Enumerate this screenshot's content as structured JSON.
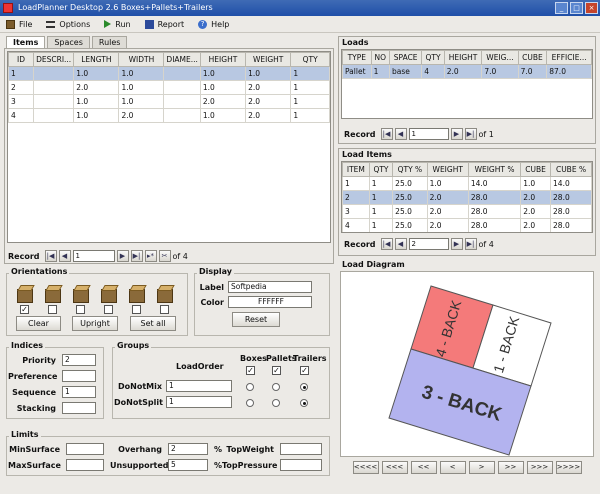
{
  "window": {
    "title": "LoadPlanner Desktop 2.6 Boxes+Pallets+Trailers"
  },
  "menu": {
    "file": "File",
    "options": "Options",
    "run": "Run",
    "report": "Report",
    "help": "Help"
  },
  "tabs": [
    "Items",
    "Spaces",
    "Rules"
  ],
  "items_table": {
    "headers": [
      "ID",
      "DESCRI...",
      "LENGTH",
      "WIDTH",
      "DIAME...",
      "HEIGHT",
      "WEIGHT",
      "QTY"
    ],
    "rows": [
      [
        "1",
        "",
        "1.0",
        "1.0",
        "",
        "1.0",
        "1.0",
        "1"
      ],
      [
        "2",
        "",
        "2.0",
        "1.0",
        "",
        "1.0",
        "2.0",
        "1"
      ],
      [
        "3",
        "",
        "1.0",
        "1.0",
        "",
        "2.0",
        "2.0",
        "1"
      ],
      [
        "4",
        "",
        "1.0",
        "2.0",
        "",
        "1.0",
        "2.0",
        "1"
      ]
    ]
  },
  "items_record": {
    "label": "Record",
    "value": "1",
    "of": "of 4"
  },
  "orientations": {
    "title": "Orientations",
    "clear": "Clear",
    "upright": "Upright",
    "set_all": "Set all"
  },
  "display": {
    "title": "Display",
    "label_label": "Label",
    "label_value": "Softpedia",
    "color_label": "Color",
    "color_value": "FFFFFF",
    "reset": "Reset"
  },
  "indices": {
    "title": "Indices",
    "priority_label": "Priority",
    "priority_value": "2",
    "preference_label": "Preference",
    "preference_value": "",
    "sequence_label": "Sequence",
    "sequence_value": "1",
    "stacking_label": "Stacking",
    "stacking_value": ""
  },
  "groups": {
    "title": "Groups",
    "loadorder": "LoadOrder",
    "boxes": "Boxes",
    "pallets": "Pallets",
    "trailers": "Trailers",
    "donotmix_label": "DoNotMix",
    "donotmix_value": "1",
    "donotsplit_label": "DoNotSplit",
    "donotsplit_value": "1"
  },
  "limits": {
    "title": "Limits",
    "minsurface": "MinSurface",
    "minsurface_value": "",
    "maxsurface": "MaxSurface",
    "maxsurface_value": "",
    "overhang": "Overhang",
    "overhang_value": "2",
    "unsupported": "Unsupported",
    "unsupported_value": "5",
    "pct": "%",
    "topweight": "TopWeight",
    "topweight_value": "",
    "toppressure": "TopPressure",
    "toppressure_value": ""
  },
  "loads": {
    "title": "Loads",
    "headers": [
      "TYPE",
      "NO",
      "SPACE",
      "QTY",
      "HEIGHT",
      "WEIG...",
      "CUBE",
      "EFFICIE..."
    ],
    "rows": [
      [
        "Pallet",
        "1",
        "base",
        "4",
        "2.0",
        "7.0",
        "7.0",
        "87.0"
      ]
    ],
    "record_label": "Record",
    "record_value": "1",
    "of": "of 1"
  },
  "load_items": {
    "title": "Load Items",
    "headers": [
      "ITEM",
      "QTY",
      "QTY %",
      "WEIGHT",
      "WEIGHT %",
      "CUBE",
      "CUBE %"
    ],
    "rows": [
      [
        "1",
        "1",
        "25.0",
        "1.0",
        "14.0",
        "1.0",
        "14.0"
      ],
      [
        "2",
        "1",
        "25.0",
        "2.0",
        "28.0",
        "2.0",
        "28.0"
      ],
      [
        "3",
        "1",
        "25.0",
        "2.0",
        "28.0",
        "2.0",
        "28.0"
      ],
      [
        "4",
        "1",
        "25.0",
        "2.0",
        "28.0",
        "2.0",
        "28.0"
      ]
    ],
    "record_label": "Record",
    "record_value": "2",
    "of": "of 4"
  },
  "load_diagram": {
    "title": "Load Diagram",
    "box_a": "4 - BACK",
    "box_b": "1 - BACK",
    "box_c": "3 - BACK",
    "color_a": "#f47a7a",
    "color_b": "#ffffff",
    "color_c": "#b3b3ef"
  },
  "diagram_nav": [
    "<<<<",
    "<<<",
    "<<",
    "<",
    ">",
    ">>",
    ">>>",
    ">>>>"
  ]
}
